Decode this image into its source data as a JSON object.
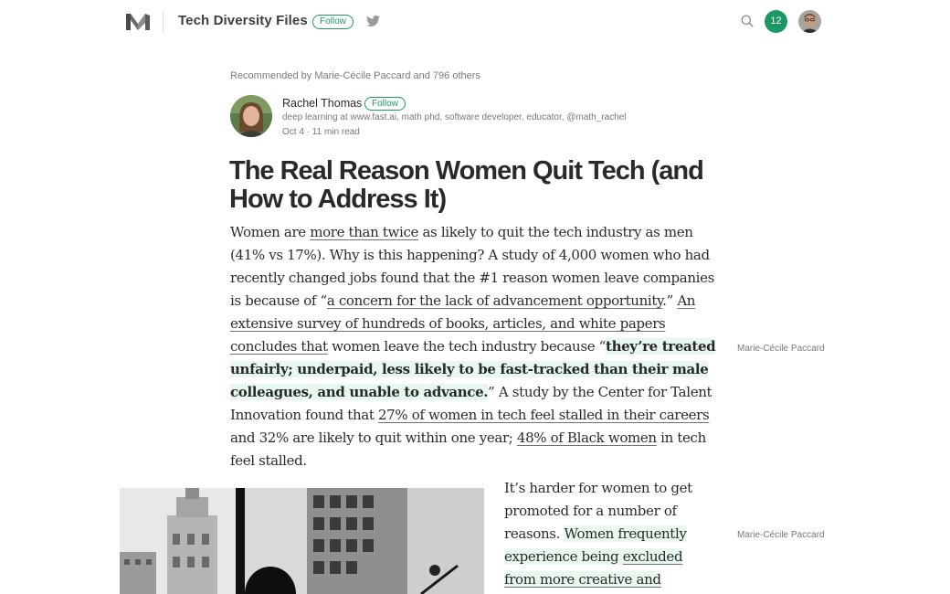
{
  "topbar": {
    "publication_name": "Tech Diversity Files",
    "follow_label": "Follow",
    "notification_count": "12",
    "logo_icon": "medium-logo-icon",
    "twitter_icon": "twitter-icon",
    "search_icon": "search-icon"
  },
  "article": {
    "recommended": "Recommended by Marie-Cécile Paccard and 796 others",
    "author": {
      "name": "Rachel Thomas",
      "follow_label": "Follow",
      "bio": "deep learning at www.fast.ai, math phd, software developer, educator, @math_rachel",
      "meta": "Oct 4 · 11 min read"
    },
    "title": "The Real Reason Women Quit Tech (and How to Address It)",
    "para1": [
      "Women are ",
      "more than twice",
      " as likely to quit the tech industry as men (41% vs 17%). Why is this happening? A study of 4,000 women who had recently changed jobs found that the #1 reason women leave companies is because of “",
      "a concern for the lack of advancement opportunity",
      ".” ",
      "An extensive survey of hundreds of books, articles, and white papers concludes that",
      " women leave the tech industry because “",
      "they’re treated unfairly; underpaid, less likely to be fast-tracked than their male colleagues, and unable to advance.",
      "” A study by the Center for Talent Innovation found that ",
      "27% of women in tech feel stalled in their careers",
      " and 32% are likely to quit within one year; ",
      "48% of Black women",
      " in tech feel stalled."
    ],
    "para2": [
      "It’s harder for women to get promoted for a number of reasons. ",
      "Women frequently experience being ",
      "excluded from more creative and innovative"
    ],
    "highlight_notes": [
      "Marie-Cécile Paccard",
      "Marie-Cécile Paccard"
    ]
  },
  "colors": {
    "accent": "#1c9963",
    "highlight": "#e9f8ef"
  }
}
